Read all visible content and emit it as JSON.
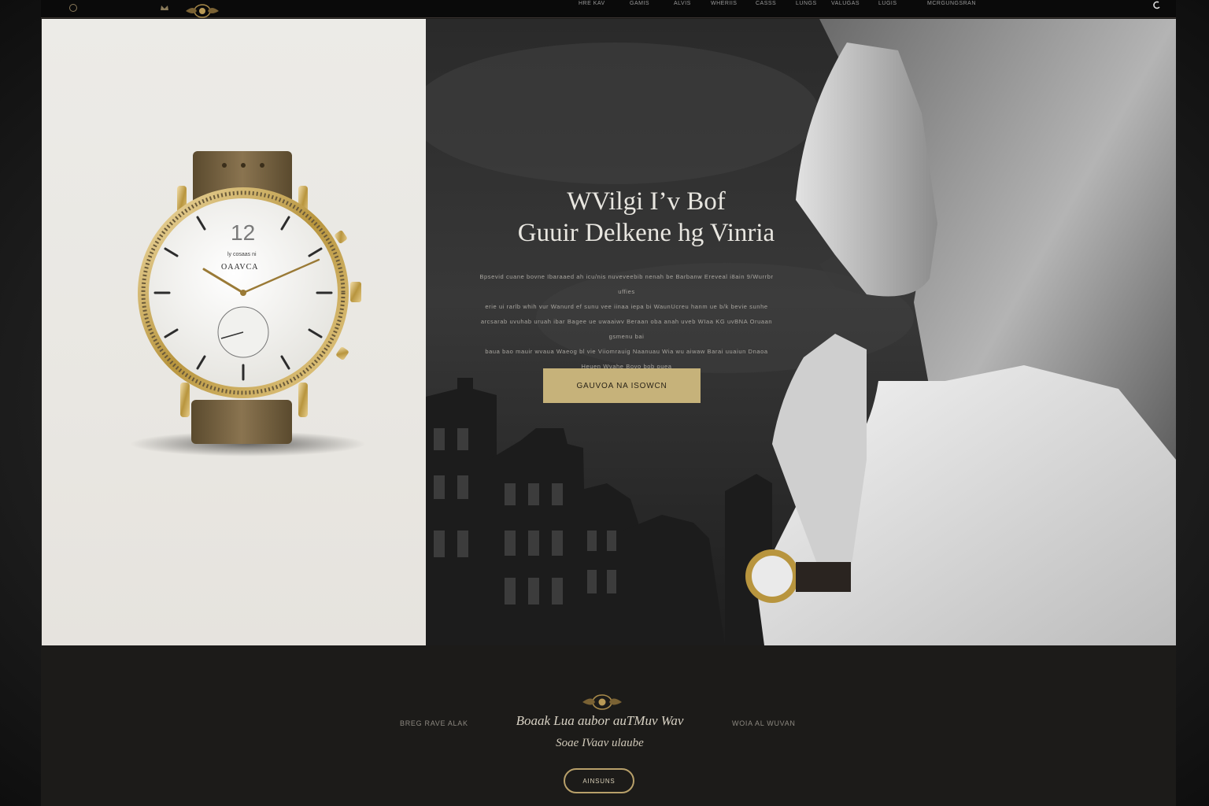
{
  "nav": {
    "items": [
      "HRE KAV",
      "GAMIS",
      "ALVIS",
      "WHERIIS",
      "CASSS",
      "LUNGS",
      "VALUGAS",
      "LUGIS",
      "MCRGUNGSRAN"
    ]
  },
  "product": {
    "dial_number": "12",
    "dial_small": "ly cosaas ni",
    "dial_brand": "OAAVCA"
  },
  "hero": {
    "title_line1": "WVilgi I&#x2019;v Bof",
    "title_line2": "Guuir Delkene hg Vinria",
    "copy_lines": [
      "Bpsevid cuane bovne Ibaraaed ah icu/nis nuveveebib nenah be Barbanw Ereveal i8ain 9/Wurrbr uffies",
      "erie ui rarlb whih vur Wanurd ef sunu vee iinaa iepa bi WaunUcreu hanm ue b/k bevie sunhe",
      "arcsarab uvuhab uruah ibar Bagee ue uwaaiwv Beraan oba anah uveb WIaa KG uvBNA Oruaan gsmenu bai",
      "baua bao mauir wvaua Waeog bl vie Viiomrauig Naanuau Wia wu aiwaw Barai uuaiun Dnaoa",
      "Heuen Wvahe Bovo bob ouea"
    ],
    "cta_label": "GAUVOA NA ISOWCN"
  },
  "footer": {
    "left_label": "BREG RAVE ALAK",
    "right_label": "WOIA AL WUVAN",
    "script_line1": "Boaak Lua aubor auTMuv Wav",
    "script_line2": "Soae IVaav ulaube",
    "button_label": "AINSUNS"
  },
  "colors": {
    "accent_gold": "#c6b27a",
    "background_dark": "#1c1b19",
    "product_bg": "#ecebe7"
  }
}
